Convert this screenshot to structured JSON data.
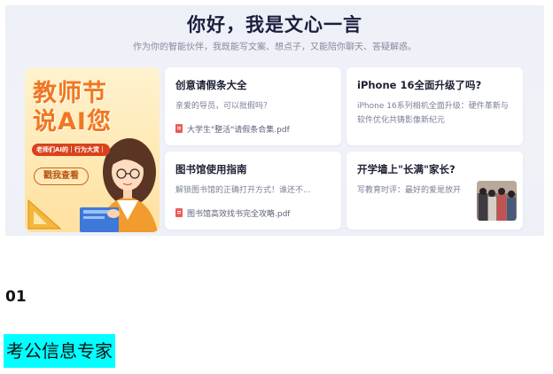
{
  "hero": {
    "title": "你好，我是文心一言",
    "subtitle": "作为你的智能伙伴，我既能写文案、想点子，又能陪你聊天、答疑解惑。"
  },
  "promo": {
    "title_line1": "教师节",
    "title_line2": "说AI您",
    "tag": "老师们AI的｜行为大赏｜",
    "button_label": "戳我查看"
  },
  "cards": [
    {
      "title": "创意请假条大全",
      "desc": "亲爱的导员，可以批假吗？",
      "file": "大学生\"整活\"请假条合集.pdf"
    },
    {
      "title": "iPhone 16全面升级了吗?",
      "desc": "iPhone 16系列相机全面升级：硬件革新与软件优化共铸影像新纪元"
    },
    {
      "title": "图书馆使用指南",
      "desc": "解锁图书馆的正确打开方式！谁还不...",
      "file": "图书馆高效找书完全攻略.pdf"
    },
    {
      "title": "开学墙上\"长满\"家长?",
      "desc": "写教育时评：最好的爱是放开"
    }
  ],
  "section": {
    "number": "01",
    "title": "考公信息专家"
  },
  "colors": {
    "accent_orange": "#f07722",
    "pdf_red": "#ec5b56",
    "highlight_cyan": "#00ffff"
  }
}
